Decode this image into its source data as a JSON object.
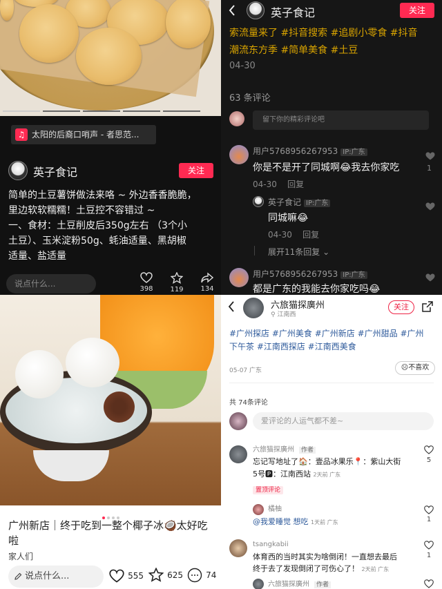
{
  "q1": {
    "music": "太阳的后裔口哨声 - 者思范...",
    "author": "英子食记",
    "follow": "关注",
    "desc_lines": [
      "简单的土豆薯饼做法来咯 ~ 外边香香脆脆，",
      "里边软软糯糯！土豆控不容错过 ~",
      "一、食材：⁠土豆削皮后350g左右 （3个小",
      "土豆）、玉米淀粉50g、蚝油适量、黑胡椒",
      "适量、盐适量"
    ],
    "comment_placeholder": "说点什么...",
    "likes": "398",
    "stars": "119",
    "shares": "134"
  },
  "q2": {
    "author": "英子食记",
    "follow": "关注",
    "tags_line1": "索流量来了 #抖音搜索 #追剧小零食 #抖音",
    "tags_line2": "潮流东方季 #简单美食 #土豆",
    "date": "04-30",
    "comment_count": "63 条评论",
    "comment_placeholder": "留下你的精彩评论吧",
    "comments": [
      {
        "user": "用户5768956267953",
        "ip": "IP:广东",
        "text": "你是不是开了同城啊😂我去你家吃",
        "date": "04-30",
        "reply": "回复",
        "likes": "1"
      },
      {
        "user": "英子食记",
        "ip": "IP:广东",
        "text": "同城嘛😂",
        "date": "04-30",
        "reply": "回复"
      },
      {
        "user": "用户5768956267953",
        "ip": "IP:广东",
        "text": "都是广东的我能去你家吃吗😂"
      }
    ],
    "expand": "展开11条回复"
  },
  "q3": {
    "title": "广州新店｜终于吃到一整个椰子冰🥥太好吃啦",
    "subtitle": "家人们",
    "comment_placeholder": "说点什么...",
    "likes": "555",
    "stars": "625",
    "comments": "74"
  },
  "q4": {
    "author": "六旅猫探廣州",
    "location": "江南西",
    "follow": "关注",
    "tags_line1": "#广州探店 #广州美食 #广州新店 #广州甜品 #广州",
    "tags_line2": "下午茶 #江南西探店 #江南西美食",
    "date": "05-07 广东",
    "dislike": "不喜欢",
    "comment_count": "共 74条评论",
    "comment_placeholder": "爱评论的人运气都不差~",
    "comments": [
      {
        "user": "六旅猫探廣州",
        "badge": "作者",
        "line1": "忘记写地址了🏠：壹品冰果乐📍：紫山大街",
        "line2": "5号🅿：江南西站",
        "meta": "2天前 广东",
        "likes": "5",
        "tag": "置顶评论"
      },
      {
        "user": "橘柚",
        "text": "@我爱睡觉 想吃",
        "meta": "1天前 广东",
        "likes": "1"
      },
      {
        "user": "tsangkabii",
        "line1": "体育西的当时其实为啥倒闭！一直想去最后",
        "line2": "终于去了发现倒闭了可伤心了！",
        "meta": "2天前 广东",
        "likes": "1"
      },
      {
        "user": "六旅猫探廣州",
        "badge": "作者"
      }
    ]
  }
}
